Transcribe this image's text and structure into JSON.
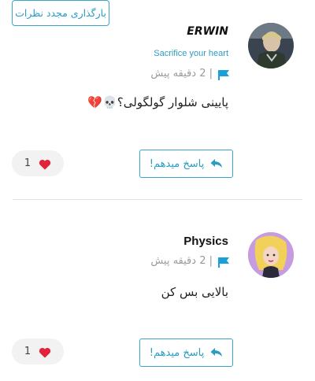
{
  "reload_button": {
    "label": "بارگذاری مجدد نظرات"
  },
  "colors": {
    "accent": "#2b9cc3",
    "flag": "#1aa0d8",
    "heart": "#e0243a",
    "muted": "#9a9a9a",
    "pill_bg": "#f2f2f2"
  },
  "comments": [
    {
      "username": "ERWIN",
      "tagline": "Sacrifice your heart",
      "time": "| 2 دقیقه پیش",
      "text": "پایینی شلوار گولگولی؟💀💔",
      "reply_label": "پاسخ میدهم!",
      "likes": "1"
    },
    {
      "username": "Physics",
      "time": "| 2 دقیقه پیش",
      "text": "بالایی بس کن",
      "reply_label": "پاسخ میدهم!",
      "likes": "1"
    }
  ]
}
